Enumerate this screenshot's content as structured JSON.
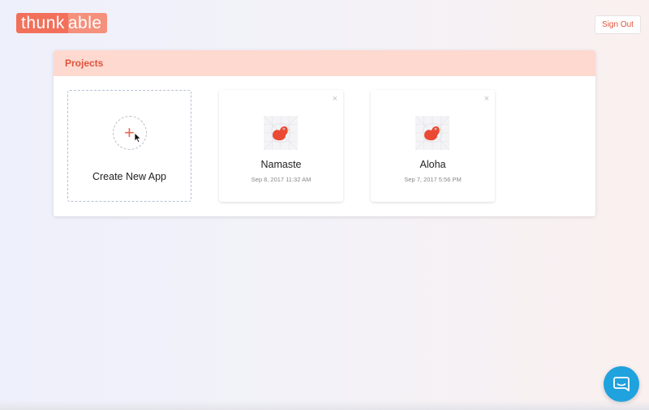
{
  "header": {
    "logo_part1": "thunk",
    "logo_part2": "able",
    "sign_out_label": "Sign Out"
  },
  "projects": {
    "title": "Projects",
    "create_label": "Create New App",
    "items": [
      {
        "name": "Namaste",
        "date": "Sep 8, 2017 11:32 AM"
      },
      {
        "name": "Aloha",
        "date": "Sep 7, 2017 5:56 PM"
      }
    ]
  },
  "icons": {
    "plus": "+",
    "close": "×"
  },
  "colors": {
    "brand": "#f2705a",
    "brand_light": "#f5907c",
    "header_bg": "#fdd9d0",
    "chat": "#1fa2de"
  }
}
